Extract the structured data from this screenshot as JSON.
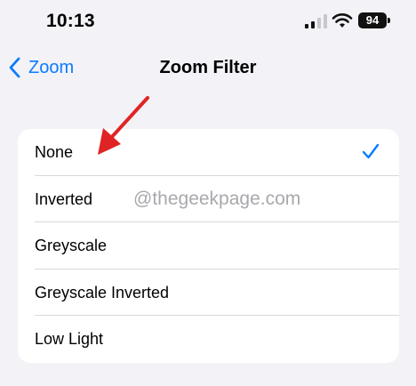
{
  "status": {
    "time": "10:13",
    "battery": "94",
    "icons": [
      "cellular-signal-icon",
      "wifi-icon",
      "battery-icon"
    ]
  },
  "nav": {
    "back_label": "Zoom",
    "title": "Zoom Filter"
  },
  "options": [
    {
      "label": "None",
      "selected": true
    },
    {
      "label": "Inverted",
      "selected": false
    },
    {
      "label": "Greyscale",
      "selected": false
    },
    {
      "label": "Greyscale Inverted",
      "selected": false
    },
    {
      "label": "Low Light",
      "selected": false
    }
  ],
  "watermark": "@thegeekpage.com",
  "colors": {
    "accent": "#0a7aff",
    "background": "#f2f2f7",
    "annotation_arrow": "#e02424"
  }
}
